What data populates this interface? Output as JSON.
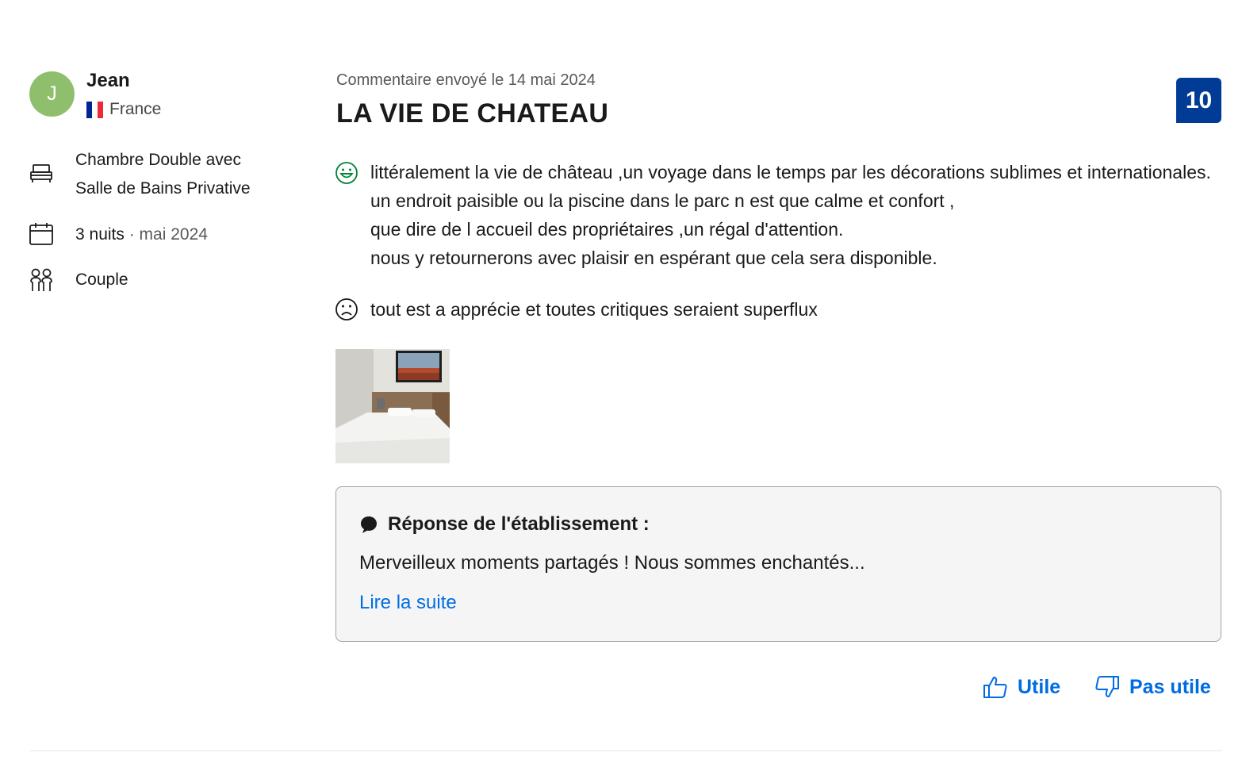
{
  "reviewer": {
    "initial": "J",
    "name": "Jean",
    "country": "France",
    "avatar_color": "#8fbf6d",
    "flag_colors": [
      "#002395",
      "#ffffff",
      "#ed2939"
    ]
  },
  "stay": {
    "room_line1": "Chambre Double avec",
    "room_line2": "Salle de Bains Privative",
    "nights": "3 nuits",
    "separator": " · ",
    "date": "mai 2024",
    "traveler_type": "Couple",
    "icons": [
      "bed-icon",
      "calendar-icon",
      "couple-icon"
    ]
  },
  "review": {
    "sent_label": "Commentaire envoyé le 14 mai 2024",
    "title": "LA VIE DE CHATEAU",
    "score": "10",
    "score_color": "#003b95",
    "positive": "littéralement la vie de château ,un voyage dans le temps par les décorations sublimes et internationales. un endroit paisible ou la piscine dans le parc n est que calme et confort ,\nque dire de l accueil des propriétaires ,un régal d'attention.\nnous y retournerons avec plaisir en espérant que cela sera disponible.",
    "negative": "tout est a apprécie et toutes critiques seraient superflux",
    "positive_icon": "smiley-happy-icon",
    "negative_icon": "smiley-sad-icon"
  },
  "response": {
    "title": "Réponse de l'établissement :",
    "text": "Merveilleux moments partagés ! Nous sommes enchantés...",
    "link": "Lire la suite",
    "icon": "speech-bubble-icon"
  },
  "votes": {
    "helpful": "Utile",
    "not_helpful": "Pas utile",
    "link_color": "#006ce4"
  }
}
